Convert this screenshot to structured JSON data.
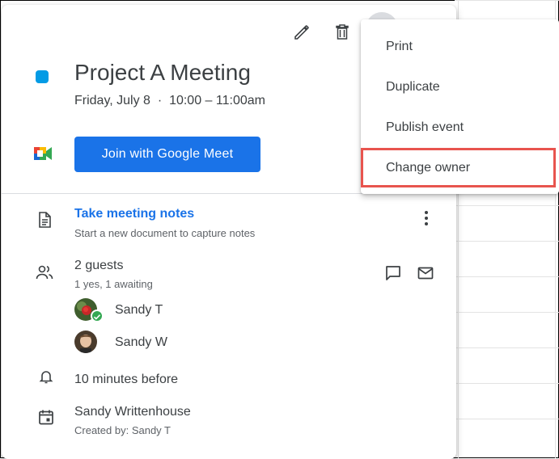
{
  "event": {
    "title": "Project A Meeting",
    "datetime": "Friday, July 8  ·  10:00 – 11:00am",
    "color": "#039be5"
  },
  "meet": {
    "join_label": "Join with Google Meet"
  },
  "notes": {
    "title": "Take meeting notes",
    "subtitle": "Start a new document to capture notes"
  },
  "guests": {
    "title": "2 guests",
    "subtitle": "1 yes, 1 awaiting",
    "list": [
      {
        "name": "Sandy T",
        "status": "accepted"
      },
      {
        "name": "Sandy W",
        "status": "awaiting"
      }
    ]
  },
  "reminder": "10 minutes before",
  "calendar": {
    "name": "Sandy Writtenhouse",
    "created_by": "Created by: Sandy T"
  },
  "menu": {
    "items": [
      {
        "label": "Print"
      },
      {
        "label": "Duplicate"
      },
      {
        "label": "Publish event"
      },
      {
        "label": "Change owner",
        "highlighted": true
      }
    ]
  },
  "icons": {
    "edit": "pencil-icon",
    "delete": "trash-icon",
    "notes": "document-icon",
    "guests": "people-icon",
    "reminder": "bell-icon",
    "calendar": "calendar-icon",
    "chat": "chat-icon",
    "email": "mail-icon",
    "more": "kebab-icon"
  },
  "colors": {
    "accent": "#1a73e8",
    "highlight": "#e8544e",
    "accepted": "#34a853"
  }
}
